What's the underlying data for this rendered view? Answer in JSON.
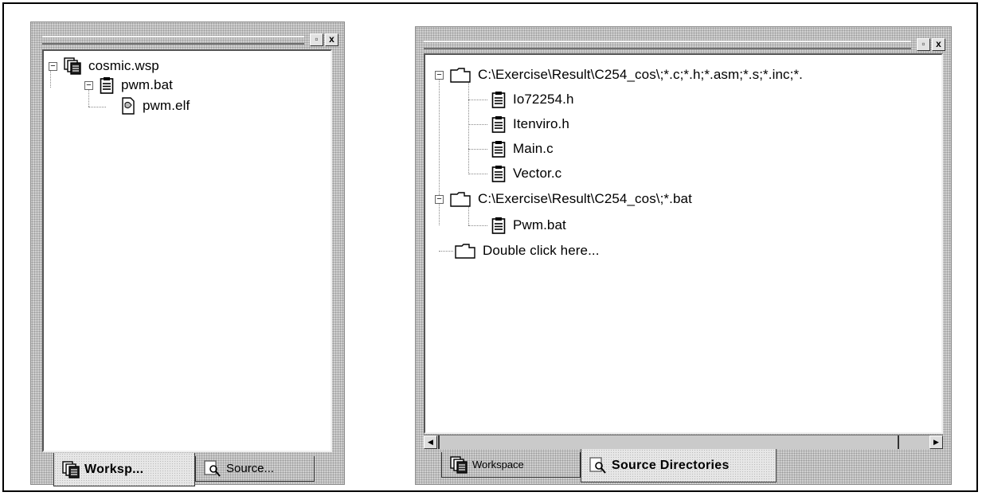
{
  "left_panel": {
    "title_buttons": {
      "restore": "▫",
      "close": "x"
    },
    "tree": [
      {
        "label": "cosmic.wsp",
        "icon": "workspace-icon",
        "expander": "−"
      },
      {
        "label": "pwm.bat",
        "icon": "clipboard-file-icon",
        "expander": "−"
      },
      {
        "label": "pwm.elf",
        "icon": "elf-file-icon"
      }
    ],
    "tabs": [
      {
        "label": "Worksp...",
        "icon": "workspace-icon",
        "active": true
      },
      {
        "label": "Source...",
        "icon": "source-search-icon",
        "active": false
      }
    ]
  },
  "right_panel": {
    "title_buttons": {
      "restore": "▫",
      "close": "x"
    },
    "tree": [
      {
        "label": "C:\\Exercise\\Result\\C254_cos\\;*.c;*.h;*.asm;*.s;*.inc;*.",
        "icon": "folder-icon",
        "expander": "−"
      },
      {
        "label": "Io72254.h",
        "icon": "clipboard-file-icon"
      },
      {
        "label": "Itenviro.h",
        "icon": "clipboard-file-icon"
      },
      {
        "label": "Main.c",
        "icon": "clipboard-file-icon"
      },
      {
        "label": "Vector.c",
        "icon": "clipboard-file-icon"
      },
      {
        "label": "C:\\Exercise\\Result\\C254_cos\\;*.bat",
        "icon": "folder-icon",
        "expander": "−"
      },
      {
        "label": "Pwm.bat",
        "icon": "clipboard-file-icon"
      },
      {
        "label": "Double click here...",
        "icon": "folder-icon"
      }
    ],
    "scrollbar": {
      "left_arrow": "◀",
      "right_arrow": "▶"
    },
    "tabs": [
      {
        "label": "Workspace",
        "icon": "workspace-icon",
        "active": false
      },
      {
        "label": "Source Directories",
        "icon": "source-search-icon",
        "active": true
      }
    ]
  }
}
